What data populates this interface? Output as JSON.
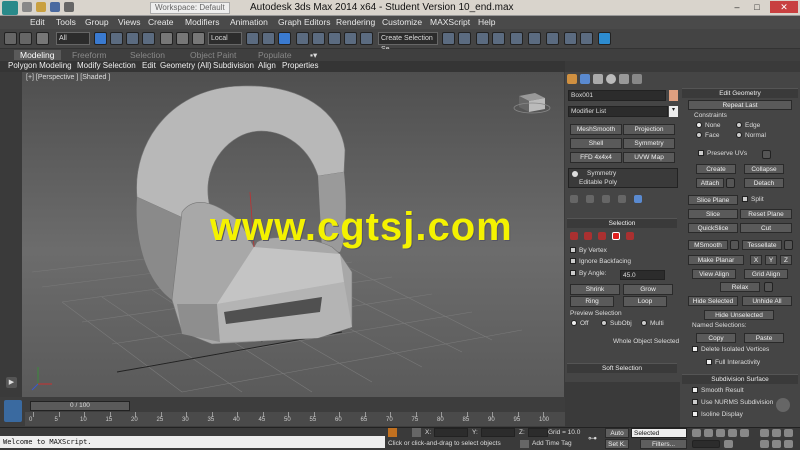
{
  "titlebar": {
    "workspace": "Workspace: Default",
    "title": "Autodesk 3ds Max  2014 x64  -  Student Version    10_end.max",
    "min": "–",
    "max": "□",
    "close": "✕"
  },
  "menu": [
    "Edit",
    "Tools",
    "Group",
    "Views",
    "Create",
    "Modifiers",
    "Animation",
    "Graph Editors",
    "Rendering",
    "Customize",
    "MAXScript",
    "Help"
  ],
  "toolbar": {
    "filter": "All",
    "coord": "Local",
    "selection_set": "Create Selection Se"
  },
  "ribbon": {
    "tabs": [
      "Modeling",
      "Freeform",
      "Selection",
      "Object Paint",
      "Populate"
    ],
    "subtabs": [
      "Polygon Modeling",
      "Modify Selection",
      "Edit",
      "Geometry (All)",
      "Subdivision",
      "Align",
      "Properties"
    ]
  },
  "viewport": {
    "label": "[+] [Perspective ] [Shaded ]",
    "watermark": "www.cgtsj.com"
  },
  "command_panel": {
    "object_name": "Box001",
    "object_color": "#e0a080",
    "modifier_list": "Modifier List",
    "modifier_buttons": [
      "MeshSmooth",
      "Projection",
      "Shell",
      "Symmetry",
      "FFD 4x4x4",
      "UVW Map"
    ],
    "stack": [
      "Symmetry",
      "Editable Poly"
    ],
    "selection": {
      "title": "Selection",
      "by_vertex": "By Vertex",
      "ignore_backfacing": "Ignore Backfacing",
      "by_angle": "By Angle:",
      "angle": "45.0",
      "shrink": "Shrink",
      "grow": "Grow",
      "ring": "Ring",
      "loop": "Loop",
      "preview": "Preview Selection",
      "off": "Off",
      "subobj": "SubObj",
      "multi": "Multi",
      "whole": "Whole Object Selected"
    },
    "soft_selection": "Soft Selection"
  },
  "edit_geometry": {
    "title": "Edit Geometry",
    "repeat_last": "Repeat Last",
    "constraints": "Constraints",
    "none": "None",
    "edge": "Edge",
    "face": "Face",
    "normal": "Normal",
    "preserve_uvs": "Preserve UVs",
    "create": "Create",
    "collapse": "Collapse",
    "attach": "Attach",
    "detach": "Detach",
    "slice_plane": "Slice Plane",
    "split": "Split",
    "slice": "Slice",
    "reset_plane": "Reset Plane",
    "quickslice": "QuickSlice",
    "cut": "Cut",
    "msmooth": "MSmooth",
    "tessellate": "Tessellate",
    "make_planar": "Make Planar",
    "x": "X",
    "y": "Y",
    "z": "Z",
    "view_align": "View Align",
    "grid_align": "Grid Align",
    "relax": "Relax",
    "hide_selected": "Hide Selected",
    "unhide_all": "Unhide All",
    "hide_unselected": "Hide Unselected",
    "named_selections": "Named Selections:",
    "copy": "Copy",
    "paste": "Paste",
    "delete_isolated": "Delete Isolated Vertices",
    "full_interactivity": "Full Interactivity"
  },
  "subdivision": {
    "title": "Subdivision Surface",
    "smooth_result": "Smooth Result",
    "use_nurms": "Use NURMS Subdivision",
    "isoline": "Isoline Display"
  },
  "timeline": {
    "slider": "0 / 100",
    "ticks": [
      "0",
      "5",
      "10",
      "15",
      "20",
      "25",
      "30",
      "35",
      "40",
      "45",
      "50",
      "55",
      "60",
      "65",
      "70",
      "75",
      "80",
      "85",
      "90",
      "95",
      "100"
    ]
  },
  "status": {
    "maxscript": "Welcome to MAXScript.",
    "prompt": "Click or click-and-drag to select objects",
    "add_time_tag": "Add Time Tag",
    "x_label": "X:",
    "y_label": "Y:",
    "z_label": "Z:",
    "grid": "Grid = 10.0",
    "auto": "Auto",
    "selected": "Selected",
    "set_key": "Set K.",
    "filters": "Filters..."
  }
}
